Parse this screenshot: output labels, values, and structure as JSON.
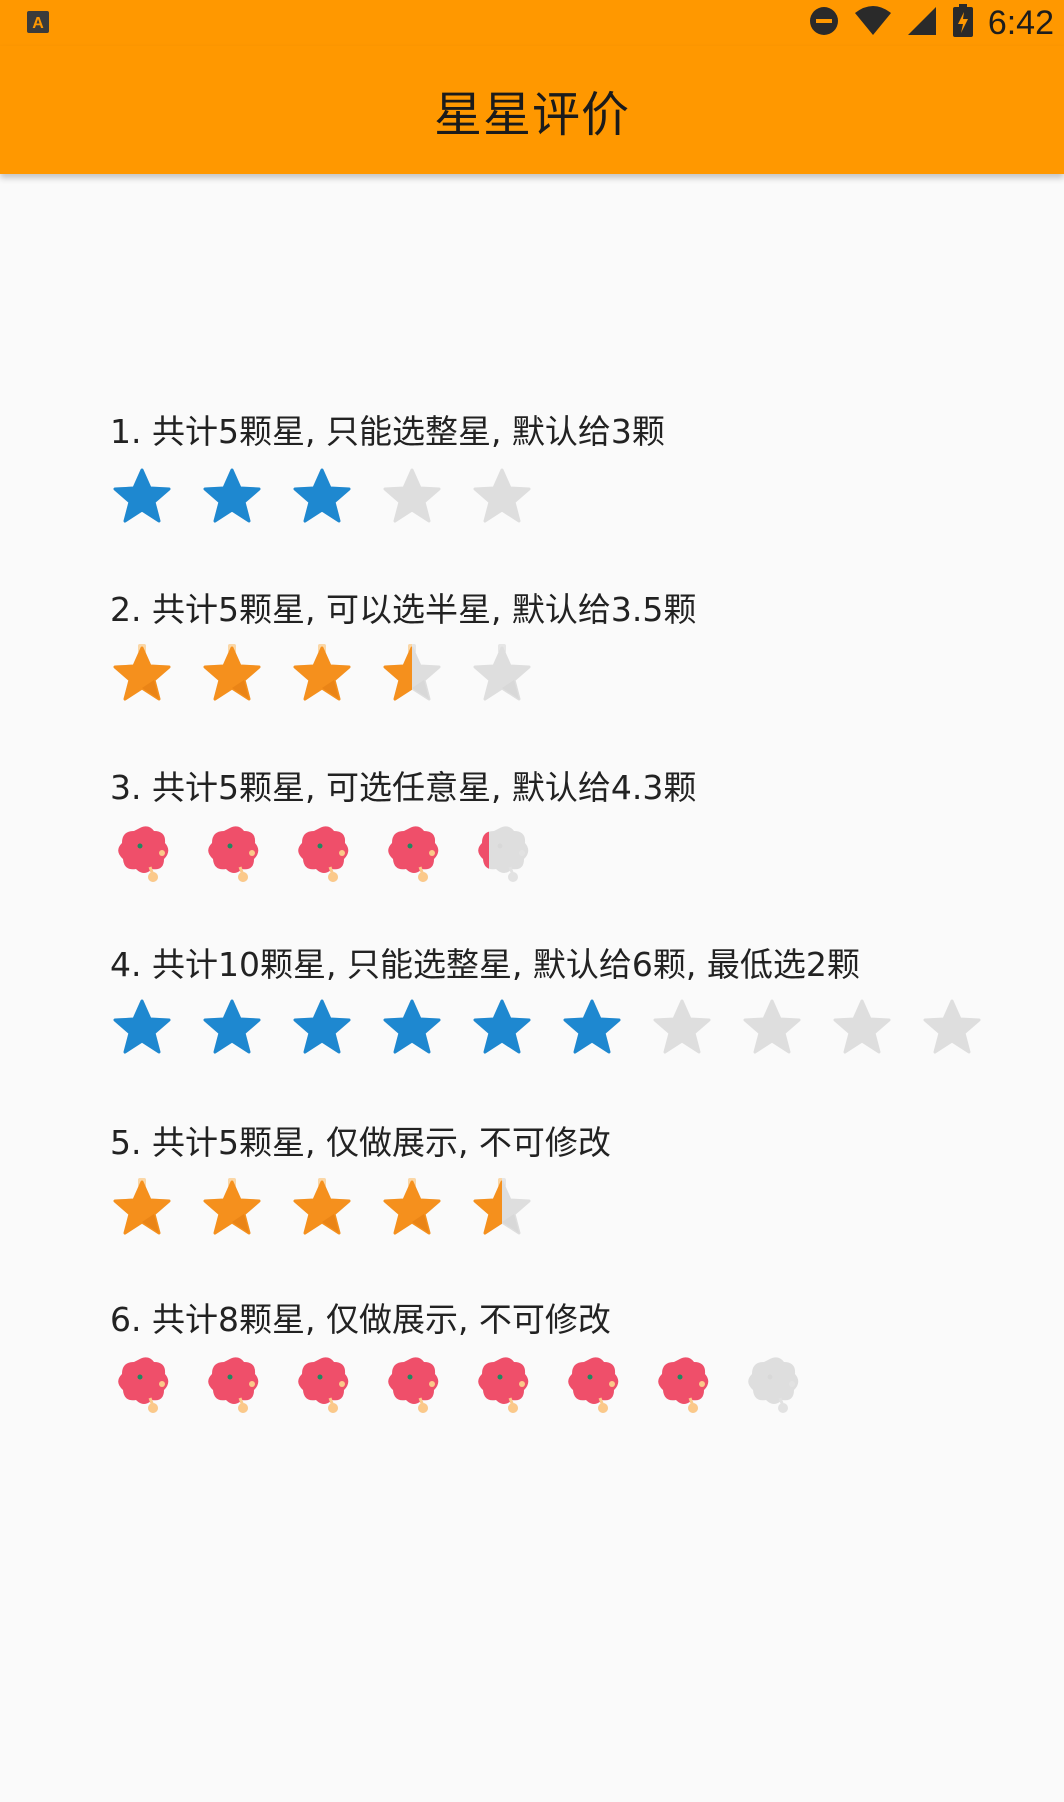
{
  "statusbar": {
    "time": "6:42",
    "left_icon": "keyboard-a-icon",
    "right_icons": [
      "do-not-disturb-icon",
      "wifi-icon",
      "cellular-signal-icon",
      "battery-charging-icon"
    ]
  },
  "appbar": {
    "title": "星星评价"
  },
  "colors": {
    "primary": "#ff9800",
    "blue_star": "#1e88d0",
    "orange_star": "#f5901d",
    "pink_flower": "#ef4f6a",
    "empty": "#dedede"
  },
  "sections": [
    {
      "label": "1. 共计5颗星, 只能选整星, 默认给3颗",
      "total": 5,
      "value": 3,
      "icon": "blue-star"
    },
    {
      "label": "2. 共计5颗星, 可以选半星, 默认给3.5颗",
      "total": 5,
      "value": 3.5,
      "icon": "orange-star"
    },
    {
      "label": "3. 共计5颗星, 可选任意星, 默认给4.3颗",
      "total": 5,
      "value": 4.3,
      "icon": "pink-flower"
    },
    {
      "label": "4. 共计10颗星, 只能选整星, 默认给6颗, 最低选2颗",
      "total": 10,
      "value": 6,
      "icon": "blue-star"
    },
    {
      "label": "5. 共计5颗星, 仅做展示, 不可修改",
      "total": 5,
      "value": 4.5,
      "icon": "orange-star"
    },
    {
      "label": "6. 共计8颗星, 仅做展示, 不可修改",
      "total": 8,
      "value": 7,
      "icon": "pink-flower"
    }
  ]
}
